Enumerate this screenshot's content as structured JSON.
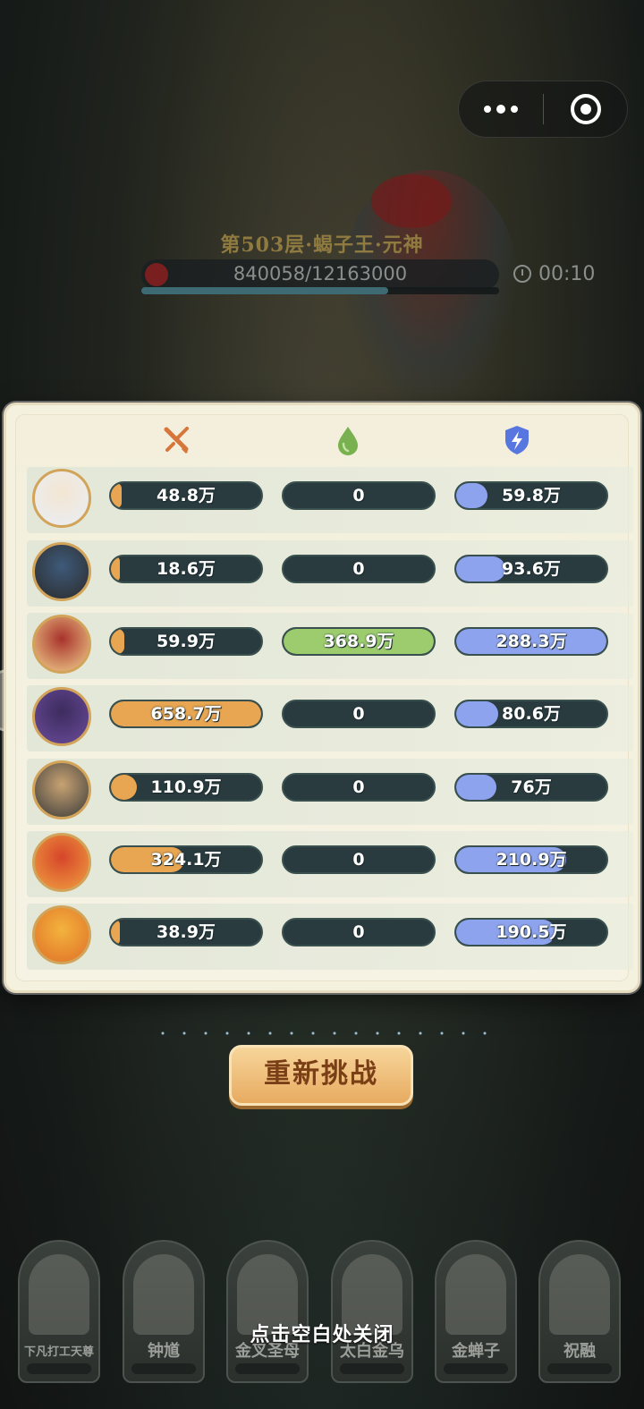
{
  "capsule": {
    "more_icon": "more-dots-icon",
    "close_icon": "target-circle-icon"
  },
  "boss": {
    "floor_title": "第503层·蝎子王·元神",
    "hp_text": "840058/12163000",
    "hp_fraction": 0.069,
    "timer": "00:10",
    "timer_icon": "clock-icon",
    "hp_icon": "hp-orb-icon"
  },
  "stats_header": {
    "attack_icon": "crossed-swords-icon",
    "heal_icon": "droplet-icon",
    "shield_icon": "lightning-shield-icon"
  },
  "colors": {
    "attack": "#e8a652",
    "heal": "#9ccc6d",
    "shield": "#8ea3ee"
  },
  "rows": [
    {
      "hero": "下凡打工天尊",
      "attack": "48.8万",
      "attack_frac": 0.07,
      "heal": "0",
      "heal_frac": 0,
      "shield": "59.8万",
      "shield_frac": 0.21
    },
    {
      "hero": "钟馗",
      "attack": "18.6万",
      "attack_frac": 0.03,
      "heal": "0",
      "heal_frac": 0,
      "shield": "93.6万",
      "shield_frac": 0.33
    },
    {
      "hero": "金叉圣母",
      "attack": "59.9万",
      "attack_frac": 0.09,
      "heal": "368.9万",
      "heal_frac": 1.0,
      "shield": "288.3万",
      "shield_frac": 1.0
    },
    {
      "hero": "太白金乌",
      "attack": "658.7万",
      "attack_frac": 1.0,
      "heal": "0",
      "heal_frac": 0,
      "shield": "80.6万",
      "shield_frac": 0.28
    },
    {
      "hero": "金蝉子",
      "attack": "110.9万",
      "attack_frac": 0.17,
      "heal": "0",
      "heal_frac": 0,
      "shield": "76万",
      "shield_frac": 0.27
    },
    {
      "hero": "祝融",
      "attack": "324.1万",
      "attack_frac": 0.49,
      "heal": "0",
      "heal_frac": 0,
      "shield": "210.9万",
      "shield_frac": 0.73
    },
    {
      "hero": "",
      "attack": "38.9万",
      "attack_frac": 0.06,
      "heal": "0",
      "heal_frac": 0,
      "shield": "190.5万",
      "shield_frac": 0.66
    }
  ],
  "retry_button": "重新挑战",
  "close_hint": "点击空白处关闭",
  "cards": [
    {
      "name": "下凡打工天尊"
    },
    {
      "name": "钟馗"
    },
    {
      "name": "金叉圣母"
    },
    {
      "name": "太白金乌"
    },
    {
      "name": "金蝉子"
    },
    {
      "name": "祝融"
    }
  ]
}
